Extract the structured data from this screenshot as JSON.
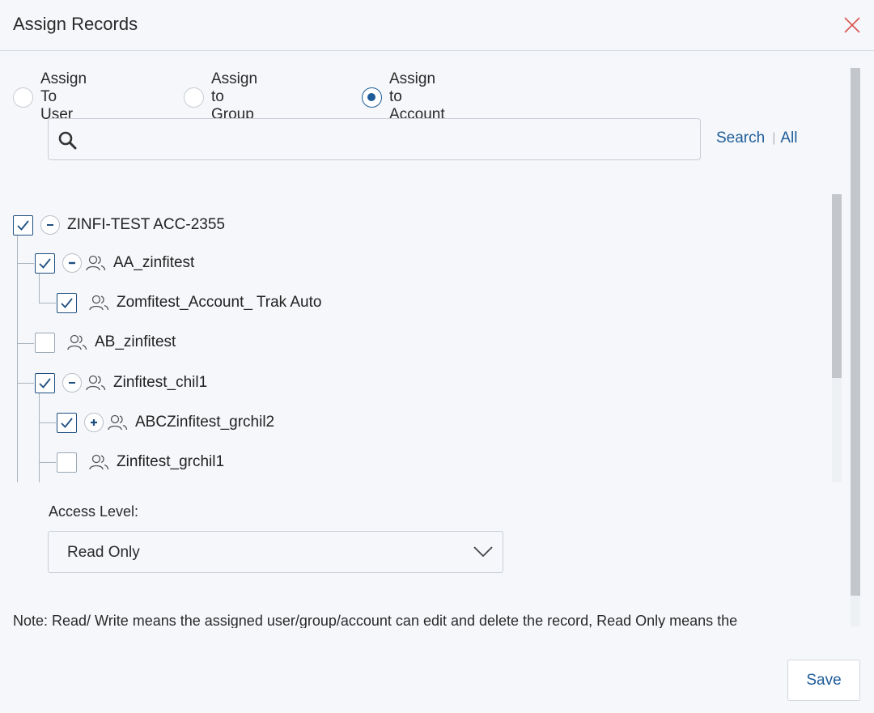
{
  "dialog": {
    "title": "Assign Records"
  },
  "assign_options": [
    {
      "label": "Assign To User",
      "selected": false
    },
    {
      "label": "Assign to Group",
      "selected": false
    },
    {
      "label": "Assign to Account",
      "selected": true
    }
  ],
  "search": {
    "value": "",
    "search_link": "Search",
    "separator": "|",
    "all_link": "All"
  },
  "tree": {
    "root": {
      "label": "ZINFI-TEST ACC-2355",
      "checked": true,
      "expanded": true
    },
    "nodes": [
      {
        "label": "AA_zinfitest",
        "checked": true,
        "expanded": true
      },
      {
        "label": "Zomfitest_Account_ Trak Auto",
        "checked": true
      },
      {
        "label": "AB_zinfitest",
        "checked": false
      },
      {
        "label": "Zinfitest_chil1",
        "checked": true,
        "expanded": true
      },
      {
        "label": "ABCZinfitest_grchil2",
        "checked": true,
        "expanded": false
      },
      {
        "label": "Zinfitest_grchil1",
        "checked": false
      }
    ]
  },
  "access": {
    "label": "Access Level:",
    "selected": "Read Only"
  },
  "note": "Note: Read/ Write means the assigned user/group/account can edit and delete the record, Read Only means the",
  "actions": {
    "save_label": "Save"
  },
  "colors": {
    "accent": "#1e5c99",
    "close": "#d9534f",
    "background": "#f5f7fa"
  }
}
